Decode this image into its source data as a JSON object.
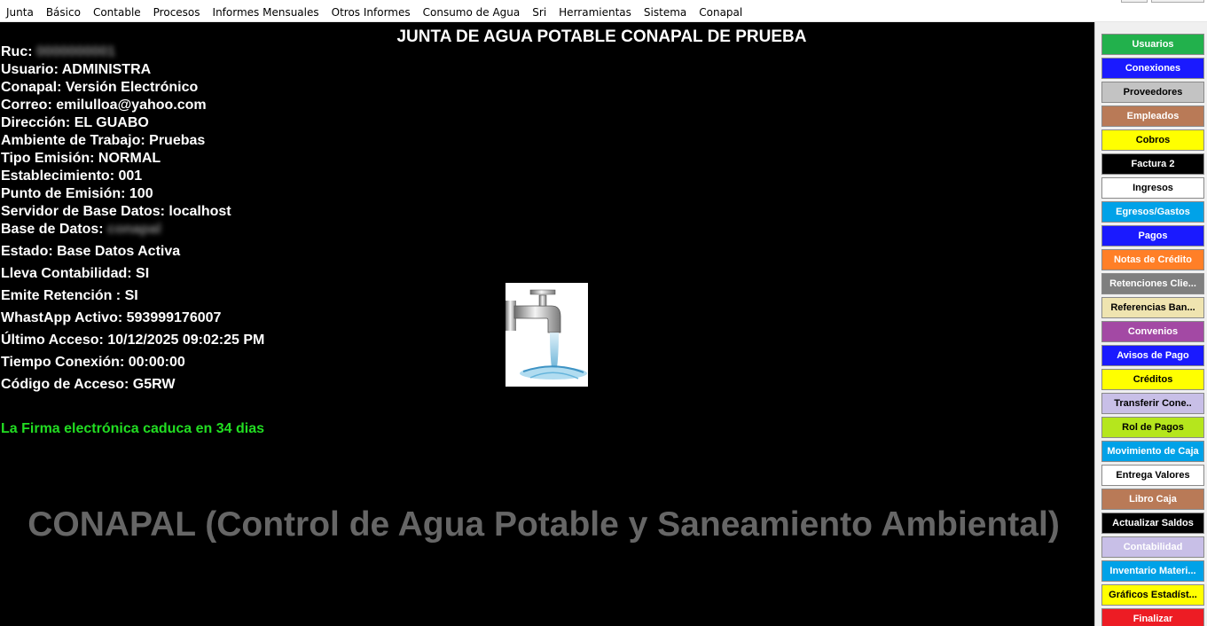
{
  "menu": [
    "Junta",
    "Básico",
    "Contable",
    "Procesos",
    "Informes Mensuales",
    "Otros Informes",
    "Consumo de Agua",
    "Sri",
    "Herramientas",
    "Sistema",
    "Conapal"
  ],
  "header": {
    "title": "JUNTA DE AGUA POTABLE CONAPAL DE PRUEBA"
  },
  "info": {
    "ruc_label": "Ruc:",
    "ruc_value": "0000000001",
    "usuario": "Usuario: ADMINISTRA",
    "conapal": "Conapal: Versión Electrónico",
    "correo": "Correo: emilulloa@yahoo.com",
    "direccion": "Dirección: EL GUABO",
    "ambiente": "Ambiente de Trabajo: Pruebas",
    "tipo_emision": "Tipo Emisión: NORMAL",
    "establecimiento": "Establecimiento: 001",
    "punto_emision": "Punto  de Emisión: 100",
    "servidor": "Servidor de Base Datos: localhost",
    "base_label": "Base de Datos:",
    "base_value": "conapal",
    "estado": "Estado: Base Datos Activa",
    "contabilidad": "Lleva Contabilidad: SI",
    "retencion": "Emite Retención : SI",
    "whatsapp": "WhastApp Activo: 593999176007",
    "ultimo_acceso": "Último Acceso: 10/12/2025 09:02:25 PM",
    "tiempo_conexion": "Tiempo Conexión: 00:00:00",
    "codigo_acceso": "Código de Acceso: G5RW"
  },
  "firma_warning": "La Firma electrónica caduca en 34 dias",
  "watermark": "CONAPAL (Control de Agua Potable y Saneamiento Ambiental)",
  "sidebar": [
    {
      "label": "Usuarios",
      "bg": "#22b14c",
      "fg": "#ffffff"
    },
    {
      "label": "Conexiones",
      "bg": "#1a1aff",
      "fg": "#ffffff"
    },
    {
      "label": "Proveedores",
      "bg": "#c3c3c3",
      "fg": "#000000"
    },
    {
      "label": "Empleados",
      "bg": "#b97a57",
      "fg": "#ffffff"
    },
    {
      "label": "Cobros",
      "bg": "#ffff00",
      "fg": "#000000"
    },
    {
      "label": "Factura 2",
      "bg": "#000000",
      "fg": "#ffffff"
    },
    {
      "label": "Ingresos",
      "bg": "#ffffff",
      "fg": "#000000"
    },
    {
      "label": "Egresos/Gastos",
      "bg": "#00a2e8",
      "fg": "#ffffff"
    },
    {
      "label": "Pagos",
      "bg": "#1a1aff",
      "fg": "#ffffff"
    },
    {
      "label": "Notas de Crédito",
      "bg": "#ff7f27",
      "fg": "#ffffff"
    },
    {
      "label": "Retenciones Clie...",
      "bg": "#7f7f7f",
      "fg": "#ffffff"
    },
    {
      "label": "Referencias Ban...",
      "bg": "#efe4b0",
      "fg": "#000000"
    },
    {
      "label": "Convenios",
      "bg": "#a349a4",
      "fg": "#ffffff"
    },
    {
      "label": "Avisos de Pago",
      "bg": "#1a1aff",
      "fg": "#ffffff"
    },
    {
      "label": "Créditos",
      "bg": "#ffff00",
      "fg": "#000000"
    },
    {
      "label": "Transferir Cone..",
      "bg": "#c8bfe7",
      "fg": "#000000"
    },
    {
      "label": "Rol de Pagos",
      "bg": "#b5e61d",
      "fg": "#000000"
    },
    {
      "label": "Movimiento de Caja",
      "bg": "#00a2e8",
      "fg": "#ffffff"
    },
    {
      "label": "Entrega Valores",
      "bg": "#ffffff",
      "fg": "#000000"
    },
    {
      "label": "Libro Caja",
      "bg": "#b97a57",
      "fg": "#ffffff"
    },
    {
      "label": "Actualizar Saldos",
      "bg": "#000000",
      "fg": "#ffffff"
    },
    {
      "label": "Contabilidad",
      "bg": "#c8bfe7",
      "fg": "#ffffff"
    },
    {
      "label": "Inventario Materi...",
      "bg": "#00a2e8",
      "fg": "#ffffff"
    },
    {
      "label": "Gráficos Estadíst...",
      "bg": "#ffff00",
      "fg": "#000000"
    },
    {
      "label": "Finalizar",
      "bg": "#ed1c24",
      "fg": "#ffffff"
    }
  ]
}
